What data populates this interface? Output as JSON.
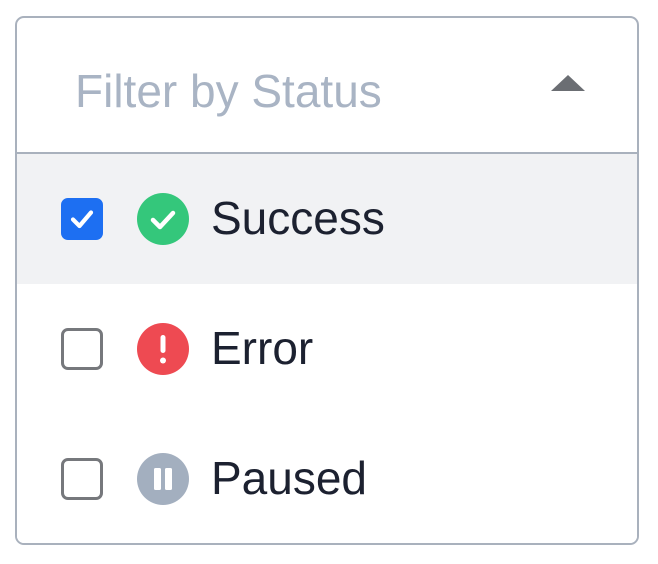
{
  "filter": {
    "placeholder": "Filter by Status",
    "expanded": true,
    "caret_icon": "caret-up-icon"
  },
  "options": [
    {
      "label": "Success",
      "checked": true,
      "icon": "check-circle-icon",
      "color": "#34c77b"
    },
    {
      "label": "Error",
      "checked": false,
      "icon": "exclamation-circle-icon",
      "color": "#ee4a52"
    },
    {
      "label": "Paused",
      "checked": false,
      "icon": "pause-circle-icon",
      "color": "#a3afbf"
    }
  ],
  "colors": {
    "checkbox_checked": "#1d6ff2",
    "selected_row_bg": "#f1f2f4",
    "border": "#a9b1bd",
    "placeholder_text": "#a9b4c4"
  }
}
